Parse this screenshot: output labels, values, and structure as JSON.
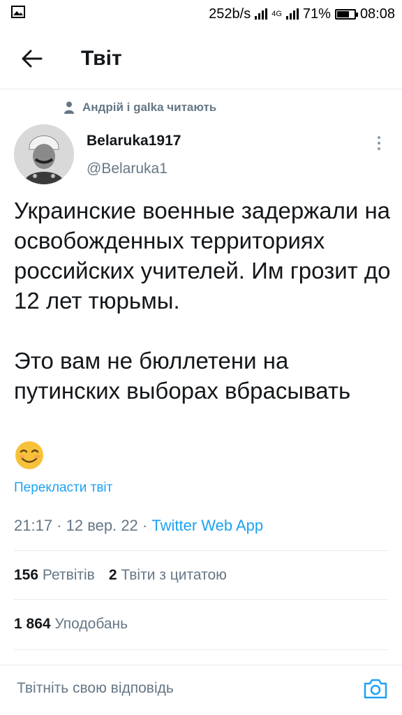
{
  "status_bar": {
    "net_speed": "252b/s",
    "network": "4G",
    "battery": "71%",
    "battery_level": 0.71,
    "time": "08:08"
  },
  "header": {
    "title": "Твіт",
    "back_icon": "arrow-left-icon"
  },
  "social_context": "Андрій і galka читають",
  "author": {
    "name": "Belaruka1917",
    "handle": "@Belaruka1"
  },
  "tweet": {
    "paragraph1": "Украинские военные задержали на освобожденных территориях российских учителей. Им грозит до 12 лет тюрьмы.",
    "paragraph2": "Это вам не бюллетени на путинских выборах вбрасывать",
    "emoji": "smiling-face-icon"
  },
  "translate_link": "Перекласти твіт",
  "meta": {
    "datetime": "21:17 · 12 вер. 22 · ",
    "source": "Twitter Web App"
  },
  "stats": {
    "retweets_count": "156",
    "retweets_label": "Ретвітів",
    "quotes_count": "2",
    "quotes_label": "Твіти з цитатою",
    "likes_count": "1 864",
    "likes_label": "Уподобань"
  },
  "reply": {
    "placeholder": "Твітніть свою відповідь"
  },
  "colors": {
    "accent": "#1da1f2",
    "secondary_text": "#657786",
    "divider": "#e6ecf0"
  }
}
